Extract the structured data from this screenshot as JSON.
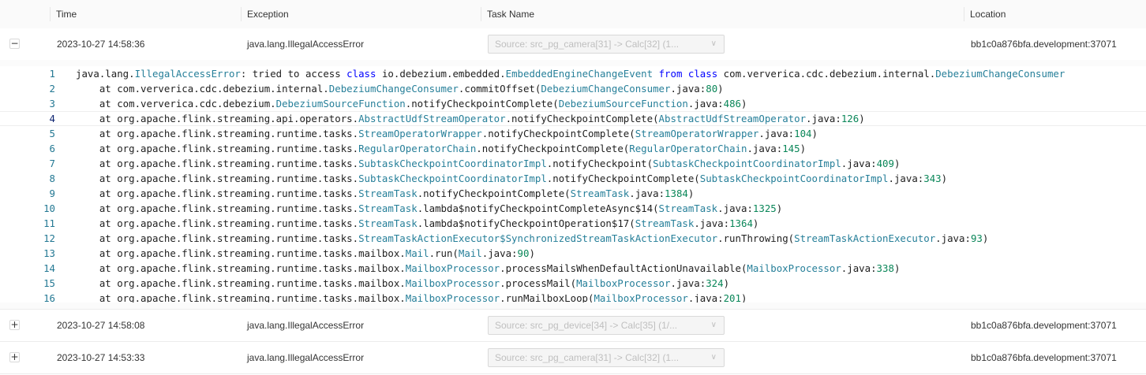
{
  "headers": {
    "time": "Time",
    "exception": "Exception",
    "task_name": "Task Name",
    "location": "Location"
  },
  "rows": [
    {
      "toggle": "−",
      "time": "2023-10-27 14:58:36",
      "exception": "java.lang.IllegalAccessError",
      "task": "Source: src_pg_camera[31] -> Calc[32] (1...",
      "location": "bb1c0a876bfa.development:37071",
      "expanded": true
    },
    {
      "toggle": "+",
      "time": "2023-10-27 14:58:08",
      "exception": "java.lang.IllegalAccessError",
      "task": "Source: src_pg_device[34] -> Calc[35] (1/...",
      "location": "bb1c0a876bfa.development:37071",
      "expanded": false
    },
    {
      "toggle": "+",
      "time": "2023-10-27 14:53:33",
      "exception": "java.lang.IllegalAccessError",
      "task": "Source: src_pg_camera[31] -> Calc[32] (1...",
      "location": "bb1c0a876bfa.development:37071",
      "expanded": false
    }
  ],
  "select_arrow_icon": "chevron-down-icon",
  "stacktrace": {
    "active_line": 4,
    "lines": [
      [
        [
          "",
          "java.lang."
        ],
        [
          "tp",
          "IllegalAccessError"
        ],
        [
          "",
          ": tried to access "
        ],
        [
          "kw",
          "class"
        ],
        [
          "",
          " io.debezium.embedded."
        ],
        [
          "tp",
          "EmbeddedEngineChangeEvent"
        ],
        [
          "",
          " "
        ],
        [
          "kw",
          "from"
        ],
        [
          "",
          " "
        ],
        [
          "kw",
          "class"
        ],
        [
          "",
          " com.ververica.cdc.debezium.internal."
        ],
        [
          "tp",
          "DebeziumChangeConsumer"
        ]
      ],
      [
        [
          "",
          "    at com.ververica.cdc.debezium.internal."
        ],
        [
          "tp",
          "DebeziumChangeConsumer"
        ],
        [
          "",
          ".commitOffset("
        ],
        [
          "tp",
          "DebeziumChangeConsumer"
        ],
        [
          "",
          ".java:"
        ],
        [
          "nm",
          "80"
        ],
        [
          "",
          ")"
        ]
      ],
      [
        [
          "",
          "    at com.ververica.cdc.debezium."
        ],
        [
          "tp",
          "DebeziumSourceFunction"
        ],
        [
          "",
          ".notifyCheckpointComplete("
        ],
        [
          "tp",
          "DebeziumSourceFunction"
        ],
        [
          "",
          ".java:"
        ],
        [
          "nm",
          "486"
        ],
        [
          "",
          ")"
        ]
      ],
      [
        [
          "",
          "    at org.apache.flink.streaming.api.operators."
        ],
        [
          "tp",
          "AbstractUdfStreamOperator"
        ],
        [
          "",
          ".notifyCheckpointComplete("
        ],
        [
          "tp",
          "AbstractUdfStreamOperator"
        ],
        [
          "",
          ".java:"
        ],
        [
          "nm",
          "126"
        ],
        [
          "",
          ")"
        ]
      ],
      [
        [
          "",
          "    at org.apache.flink.streaming.runtime.tasks."
        ],
        [
          "tp",
          "StreamOperatorWrapper"
        ],
        [
          "",
          ".notifyCheckpointComplete("
        ],
        [
          "tp",
          "StreamOperatorWrapper"
        ],
        [
          "",
          ".java:"
        ],
        [
          "nm",
          "104"
        ],
        [
          "",
          ")"
        ]
      ],
      [
        [
          "",
          "    at org.apache.flink.streaming.runtime.tasks."
        ],
        [
          "tp",
          "RegularOperatorChain"
        ],
        [
          "",
          ".notifyCheckpointComplete("
        ],
        [
          "tp",
          "RegularOperatorChain"
        ],
        [
          "",
          ".java:"
        ],
        [
          "nm",
          "145"
        ],
        [
          "",
          ")"
        ]
      ],
      [
        [
          "",
          "    at org.apache.flink.streaming.runtime.tasks."
        ],
        [
          "tp",
          "SubtaskCheckpointCoordinatorImpl"
        ],
        [
          "",
          ".notifyCheckpoint("
        ],
        [
          "tp",
          "SubtaskCheckpointCoordinatorImpl"
        ],
        [
          "",
          ".java:"
        ],
        [
          "nm",
          "409"
        ],
        [
          "",
          ")"
        ]
      ],
      [
        [
          "",
          "    at org.apache.flink.streaming.runtime.tasks."
        ],
        [
          "tp",
          "SubtaskCheckpointCoordinatorImpl"
        ],
        [
          "",
          ".notifyCheckpointComplete("
        ],
        [
          "tp",
          "SubtaskCheckpointCoordinatorImpl"
        ],
        [
          "",
          ".java:"
        ],
        [
          "nm",
          "343"
        ],
        [
          "",
          ")"
        ]
      ],
      [
        [
          "",
          "    at org.apache.flink.streaming.runtime.tasks."
        ],
        [
          "tp",
          "StreamTask"
        ],
        [
          "",
          ".notifyCheckpointComplete("
        ],
        [
          "tp",
          "StreamTask"
        ],
        [
          "",
          ".java:"
        ],
        [
          "nm",
          "1384"
        ],
        [
          "",
          ")"
        ]
      ],
      [
        [
          "",
          "    at org.apache.flink.streaming.runtime.tasks."
        ],
        [
          "tp",
          "StreamTask"
        ],
        [
          "",
          ".lambda$notifyCheckpointCompleteAsync$14("
        ],
        [
          "tp",
          "StreamTask"
        ],
        [
          "",
          ".java:"
        ],
        [
          "nm",
          "1325"
        ],
        [
          "",
          ")"
        ]
      ],
      [
        [
          "",
          "    at org.apache.flink.streaming.runtime.tasks."
        ],
        [
          "tp",
          "StreamTask"
        ],
        [
          "",
          ".lambda$notifyCheckpointOperation$17("
        ],
        [
          "tp",
          "StreamTask"
        ],
        [
          "",
          ".java:"
        ],
        [
          "nm",
          "1364"
        ],
        [
          "",
          ")"
        ]
      ],
      [
        [
          "",
          "    at org.apache.flink.streaming.runtime.tasks."
        ],
        [
          "tp",
          "StreamTaskActionExecutor$SynchronizedStreamTaskActionExecutor"
        ],
        [
          "",
          ".runThrowing("
        ],
        [
          "tp",
          "StreamTaskActionExecutor"
        ],
        [
          "",
          ".java:"
        ],
        [
          "nm",
          "93"
        ],
        [
          "",
          ")"
        ]
      ],
      [
        [
          "",
          "    at org.apache.flink.streaming.runtime.tasks.mailbox."
        ],
        [
          "tp",
          "Mail"
        ],
        [
          "",
          ".run("
        ],
        [
          "tp",
          "Mail"
        ],
        [
          "",
          ".java:"
        ],
        [
          "nm",
          "90"
        ],
        [
          "",
          ")"
        ]
      ],
      [
        [
          "",
          "    at org.apache.flink.streaming.runtime.tasks.mailbox."
        ],
        [
          "tp",
          "MailboxProcessor"
        ],
        [
          "",
          ".processMailsWhenDefaultActionUnavailable("
        ],
        [
          "tp",
          "MailboxProcessor"
        ],
        [
          "",
          ".java:"
        ],
        [
          "nm",
          "338"
        ],
        [
          "",
          ")"
        ]
      ],
      [
        [
          "",
          "    at org.apache.flink.streaming.runtime.tasks.mailbox."
        ],
        [
          "tp",
          "MailboxProcessor"
        ],
        [
          "",
          ".processMail("
        ],
        [
          "tp",
          "MailboxProcessor"
        ],
        [
          "",
          ".java:"
        ],
        [
          "nm",
          "324"
        ],
        [
          "",
          ")"
        ]
      ],
      [
        [
          "",
          "    at org.apache.flink.streaming.runtime.tasks.mailbox."
        ],
        [
          "tp",
          "MailboxProcessor"
        ],
        [
          "",
          ".runMailboxLoop("
        ],
        [
          "tp",
          "MailboxProcessor"
        ],
        [
          "",
          ".java:"
        ],
        [
          "nm",
          "201"
        ],
        [
          "",
          ")"
        ]
      ]
    ]
  }
}
